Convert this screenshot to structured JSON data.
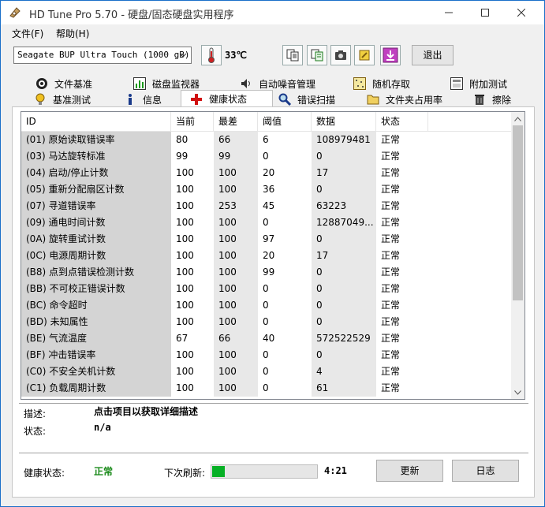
{
  "window": {
    "title": "HD Tune Pro 5.70 - 硬盘/固态硬盘实用程序"
  },
  "menu": {
    "file": "文件(F)",
    "help": "帮助(H)"
  },
  "toolbar": {
    "drive": "Seagate BUP Ultra Touch (1000 gB)",
    "temperature": "33℃",
    "exit_label": "退出"
  },
  "tabs_top": [
    {
      "label": "文件基准",
      "icon": "file-benchmark-icon"
    },
    {
      "label": "磁盘监视器",
      "icon": "disk-monitor-icon"
    },
    {
      "label": "自动噪音管理",
      "icon": "speaker-icon"
    },
    {
      "label": "随机存取",
      "icon": "random-access-icon"
    },
    {
      "label": "附加测试",
      "icon": "extra-tests-icon"
    }
  ],
  "tabs_bottom": [
    {
      "label": "基准测试",
      "icon": "benchmark-icon"
    },
    {
      "label": "信息",
      "icon": "info-icon"
    },
    {
      "label": "健康状态",
      "icon": "health-cross-icon"
    },
    {
      "label": "错误扫描",
      "icon": "magnifier-icon"
    },
    {
      "label": "文件夹占用率",
      "icon": "folder-icon"
    },
    {
      "label": "擦除",
      "icon": "trash-icon"
    }
  ],
  "table": {
    "columns": [
      "ID",
      "当前",
      "最差",
      "阈值",
      "数据",
      "状态"
    ],
    "rows": [
      [
        "(01) 原始读取错误率",
        "80",
        "66",
        "6",
        "108979481",
        "正常"
      ],
      [
        "(03) 马达旋转标准",
        "99",
        "99",
        "0",
        "0",
        "正常"
      ],
      [
        "(04) 启动/停止计数",
        "100",
        "100",
        "20",
        "17",
        "正常"
      ],
      [
        "(05) 重新分配扇区计数",
        "100",
        "100",
        "36",
        "0",
        "正常"
      ],
      [
        "(07) 寻道错误率",
        "100",
        "253",
        "45",
        "63223",
        "正常"
      ],
      [
        "(09) 通电时间计数",
        "100",
        "100",
        "0",
        "12887049...",
        "正常"
      ],
      [
        "(0A) 旋转重试计数",
        "100",
        "100",
        "97",
        "0",
        "正常"
      ],
      [
        "(0C) 电源周期计数",
        "100",
        "100",
        "20",
        "17",
        "正常"
      ],
      [
        "(B8) 点到点错误检测计数",
        "100",
        "100",
        "99",
        "0",
        "正常"
      ],
      [
        "(BB) 不可校正错误计数",
        "100",
        "100",
        "0",
        "0",
        "正常"
      ],
      [
        "(BC) 命令超时",
        "100",
        "100",
        "0",
        "0",
        "正常"
      ],
      [
        "(BD) 未知属性",
        "100",
        "100",
        "0",
        "0",
        "正常"
      ],
      [
        "(BE) 气流温度",
        "67",
        "66",
        "40",
        "572522529",
        "正常"
      ],
      [
        "(BF) 冲击错误率",
        "100",
        "100",
        "0",
        "0",
        "正常"
      ],
      [
        "(C0) 不安全关机计数",
        "100",
        "100",
        "0",
        "4",
        "正常"
      ],
      [
        "(C1) 负载周期计数",
        "100",
        "100",
        "0",
        "61",
        "正常"
      ]
    ]
  },
  "details": {
    "desc_label": "描述:",
    "desc_value": "点击项目以获取详细描述",
    "status_label": "状态:",
    "status_value": "n/a"
  },
  "footer": {
    "health_label": "健康状态:",
    "health_value": "正常",
    "refresh_label": "下次刷新:",
    "refresh_progress": 0.12,
    "timer": "4:21",
    "update_label": "更新",
    "log_label": "日志"
  },
  "colors": {
    "health_ok": "#1a8a1a",
    "progress": "#06b025"
  }
}
